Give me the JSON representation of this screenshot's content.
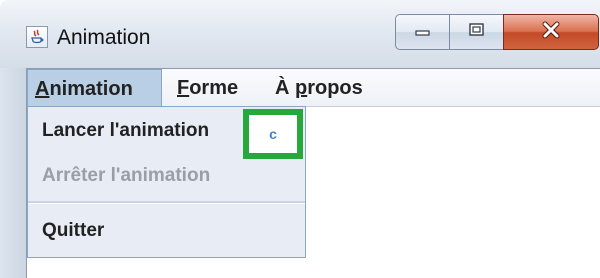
{
  "window": {
    "title": "Animation",
    "app_icon": "java-icon",
    "controls": {
      "minimize_icon": "minimize-icon",
      "maximize_icon": "maximize-icon",
      "close_icon": "close-icon"
    }
  },
  "menubar": {
    "items": [
      {
        "mnemonic": "A",
        "rest": "nimation",
        "state": "open"
      },
      {
        "mnemonic": "F",
        "rest": "orme"
      },
      {
        "prefix": "À ",
        "mnemonic": "p",
        "rest": "ropos"
      }
    ]
  },
  "dropdown": {
    "items": [
      {
        "label": "Lancer l'animation",
        "enabled": true
      },
      {
        "label": "Arrêter l'animation",
        "enabled": false
      },
      {
        "label": "Quitter",
        "enabled": true
      }
    ]
  },
  "highlight": {
    "glyph": "c",
    "color": "#27a83b"
  },
  "colors": {
    "menu_selected": "#b8cfe5",
    "close_button": "#c44a28",
    "disabled_text": "#9a9fa7"
  }
}
